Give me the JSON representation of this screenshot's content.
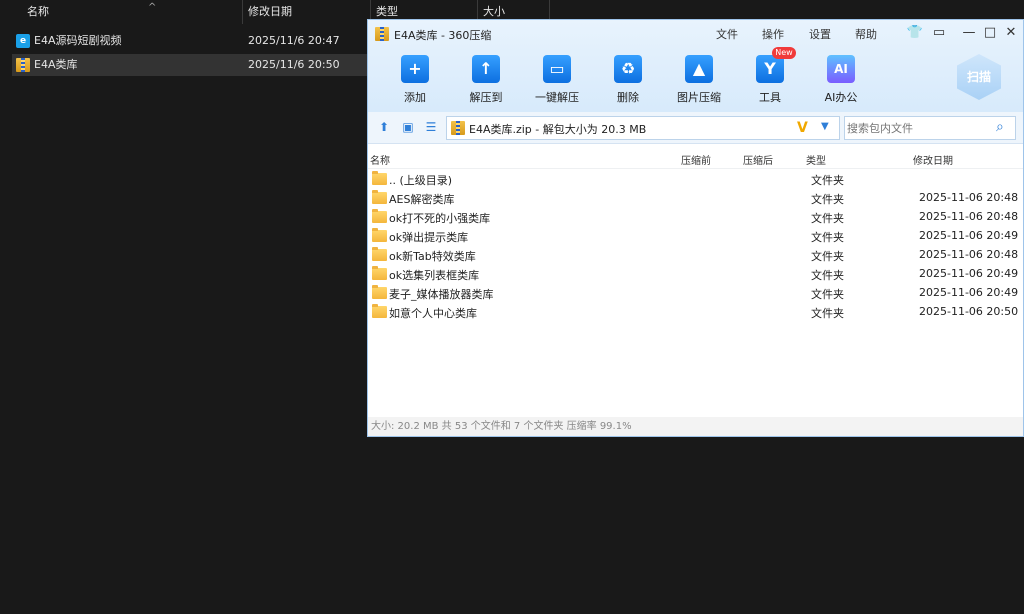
{
  "explorer": {
    "columns": [
      "名称",
      "修改日期",
      "类型",
      "大小"
    ],
    "sort_indicator": "^",
    "rows": [
      {
        "name": "E4A源码短剧视频",
        "date": "2025/11/6 20:47",
        "icon": "app-icon"
      },
      {
        "name": "E4A类库",
        "date": "2025/11/6 20:50",
        "icon": "zip-icon"
      }
    ]
  },
  "window": {
    "title": "E4A类库 - 360压缩",
    "menu": [
      "文件",
      "操作",
      "设置",
      "帮助"
    ],
    "toolbar": [
      {
        "label": "添加",
        "icon": "+"
      },
      {
        "label": "解压到",
        "icon": "↑"
      },
      {
        "label": "一键解压",
        "icon": "▭"
      },
      {
        "label": "删除",
        "icon": "♻"
      },
      {
        "label": "图片压缩",
        "icon": "▲"
      },
      {
        "label": "工具",
        "icon": "Y"
      },
      {
        "label": "AI办公",
        "icon": "AI"
      }
    ],
    "new_badge": "New",
    "scan_label": "扫描",
    "path": "E4A类库.zip - 解包大小为 20.3 MB",
    "search_placeholder": "搜索包内文件",
    "list_headers": {
      "name": "名称",
      "before": "压缩前",
      "after": "压缩后",
      "type": "类型",
      "date": "修改日期"
    },
    "files": [
      {
        "name": ".. (上级目录)",
        "type": "文件夹",
        "date": ""
      },
      {
        "name": "AES解密类库",
        "type": "文件夹",
        "date": "2025-11-06 20:48"
      },
      {
        "name": "ok打不死的小强类库",
        "type": "文件夹",
        "date": "2025-11-06 20:48"
      },
      {
        "name": "ok弹出提示类库",
        "type": "文件夹",
        "date": "2025-11-06 20:49"
      },
      {
        "name": "ok新Tab特效类库",
        "type": "文件夹",
        "date": "2025-11-06 20:48"
      },
      {
        "name": "ok选集列表框类库",
        "type": "文件夹",
        "date": "2025-11-06 20:49"
      },
      {
        "name": "麦子_媒体播放器类库",
        "type": "文件夹",
        "date": "2025-11-06 20:49"
      },
      {
        "name": "如意个人中心类库",
        "type": "文件夹",
        "date": "2025-11-06 20:50"
      }
    ],
    "status": "大小: 20.2 MB 共 53 个文件和 7 个文件夹 压缩率 99.1%"
  }
}
